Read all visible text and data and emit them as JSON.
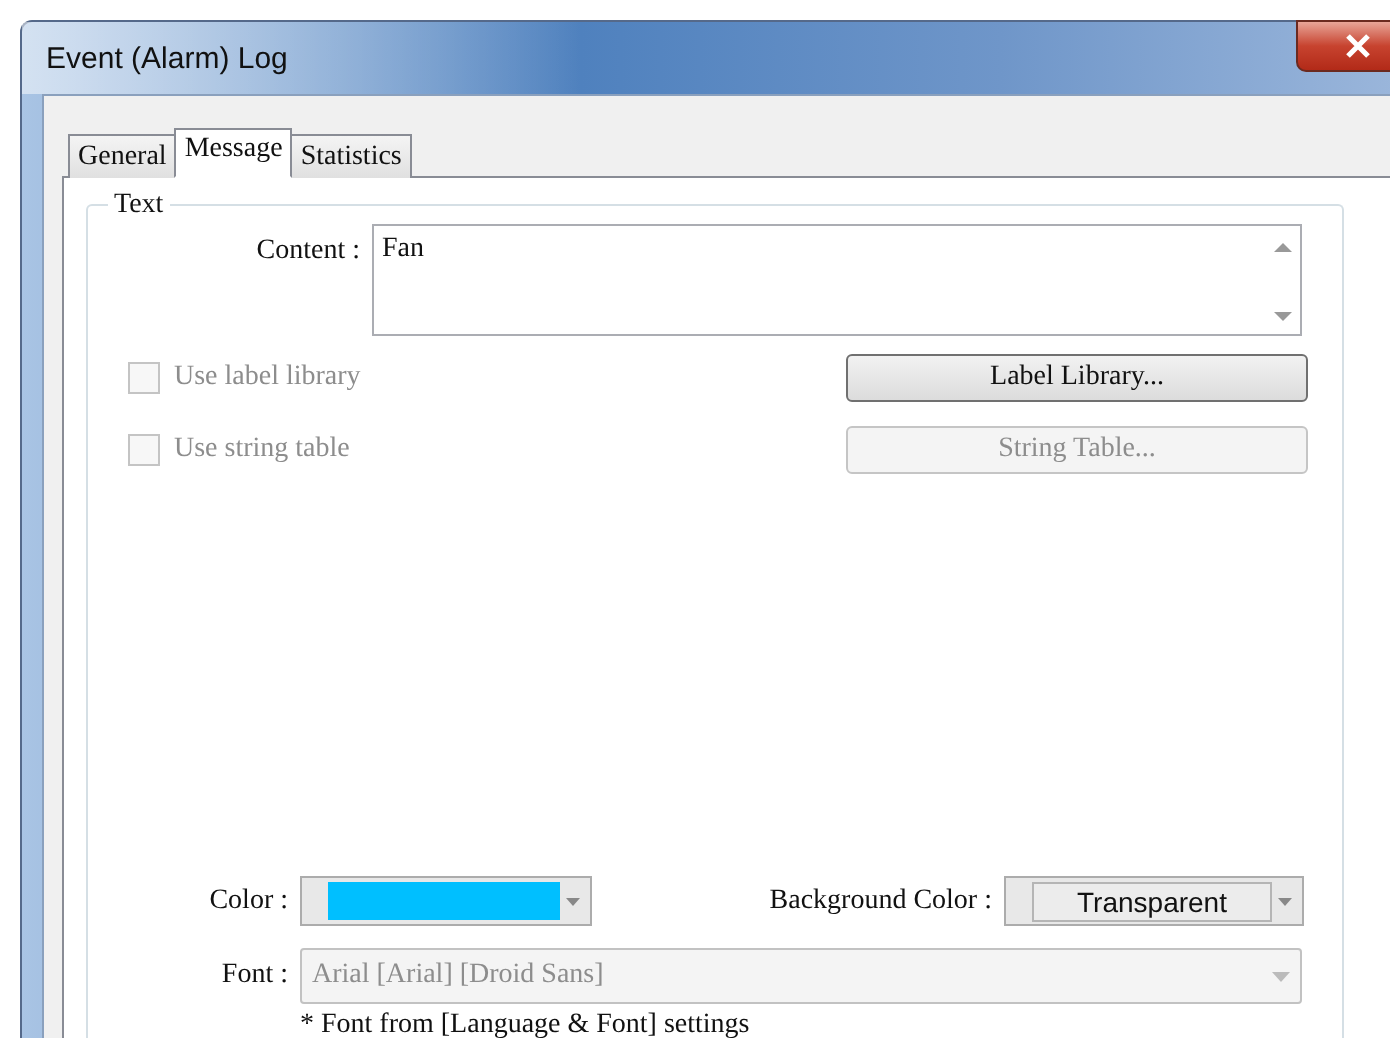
{
  "window": {
    "title": "Event (Alarm) Log"
  },
  "tabs": [
    {
      "label": "General",
      "selected": false
    },
    {
      "label": "Message",
      "selected": true
    },
    {
      "label": "Statistics",
      "selected": false
    }
  ],
  "group": {
    "title": "Text"
  },
  "content": {
    "label": "Content :",
    "value": "Fan"
  },
  "options": [
    {
      "label": "Use label library",
      "checked": false,
      "disabled": true,
      "button": {
        "label": "Label Library...",
        "disabled": false
      }
    },
    {
      "label": "Use string table",
      "checked": false,
      "disabled": true,
      "button": {
        "label": "String Table...",
        "disabled": true
      }
    }
  ],
  "color": {
    "label": "Color :",
    "color": "#00bfff"
  },
  "background_color": {
    "label": "Background Color :",
    "value": "Transparent"
  },
  "font": {
    "label": "Font :",
    "value": "Arial [Arial] [Droid Sans]",
    "disabled": true
  },
  "note": "* Font from [Language & Font] settings"
}
